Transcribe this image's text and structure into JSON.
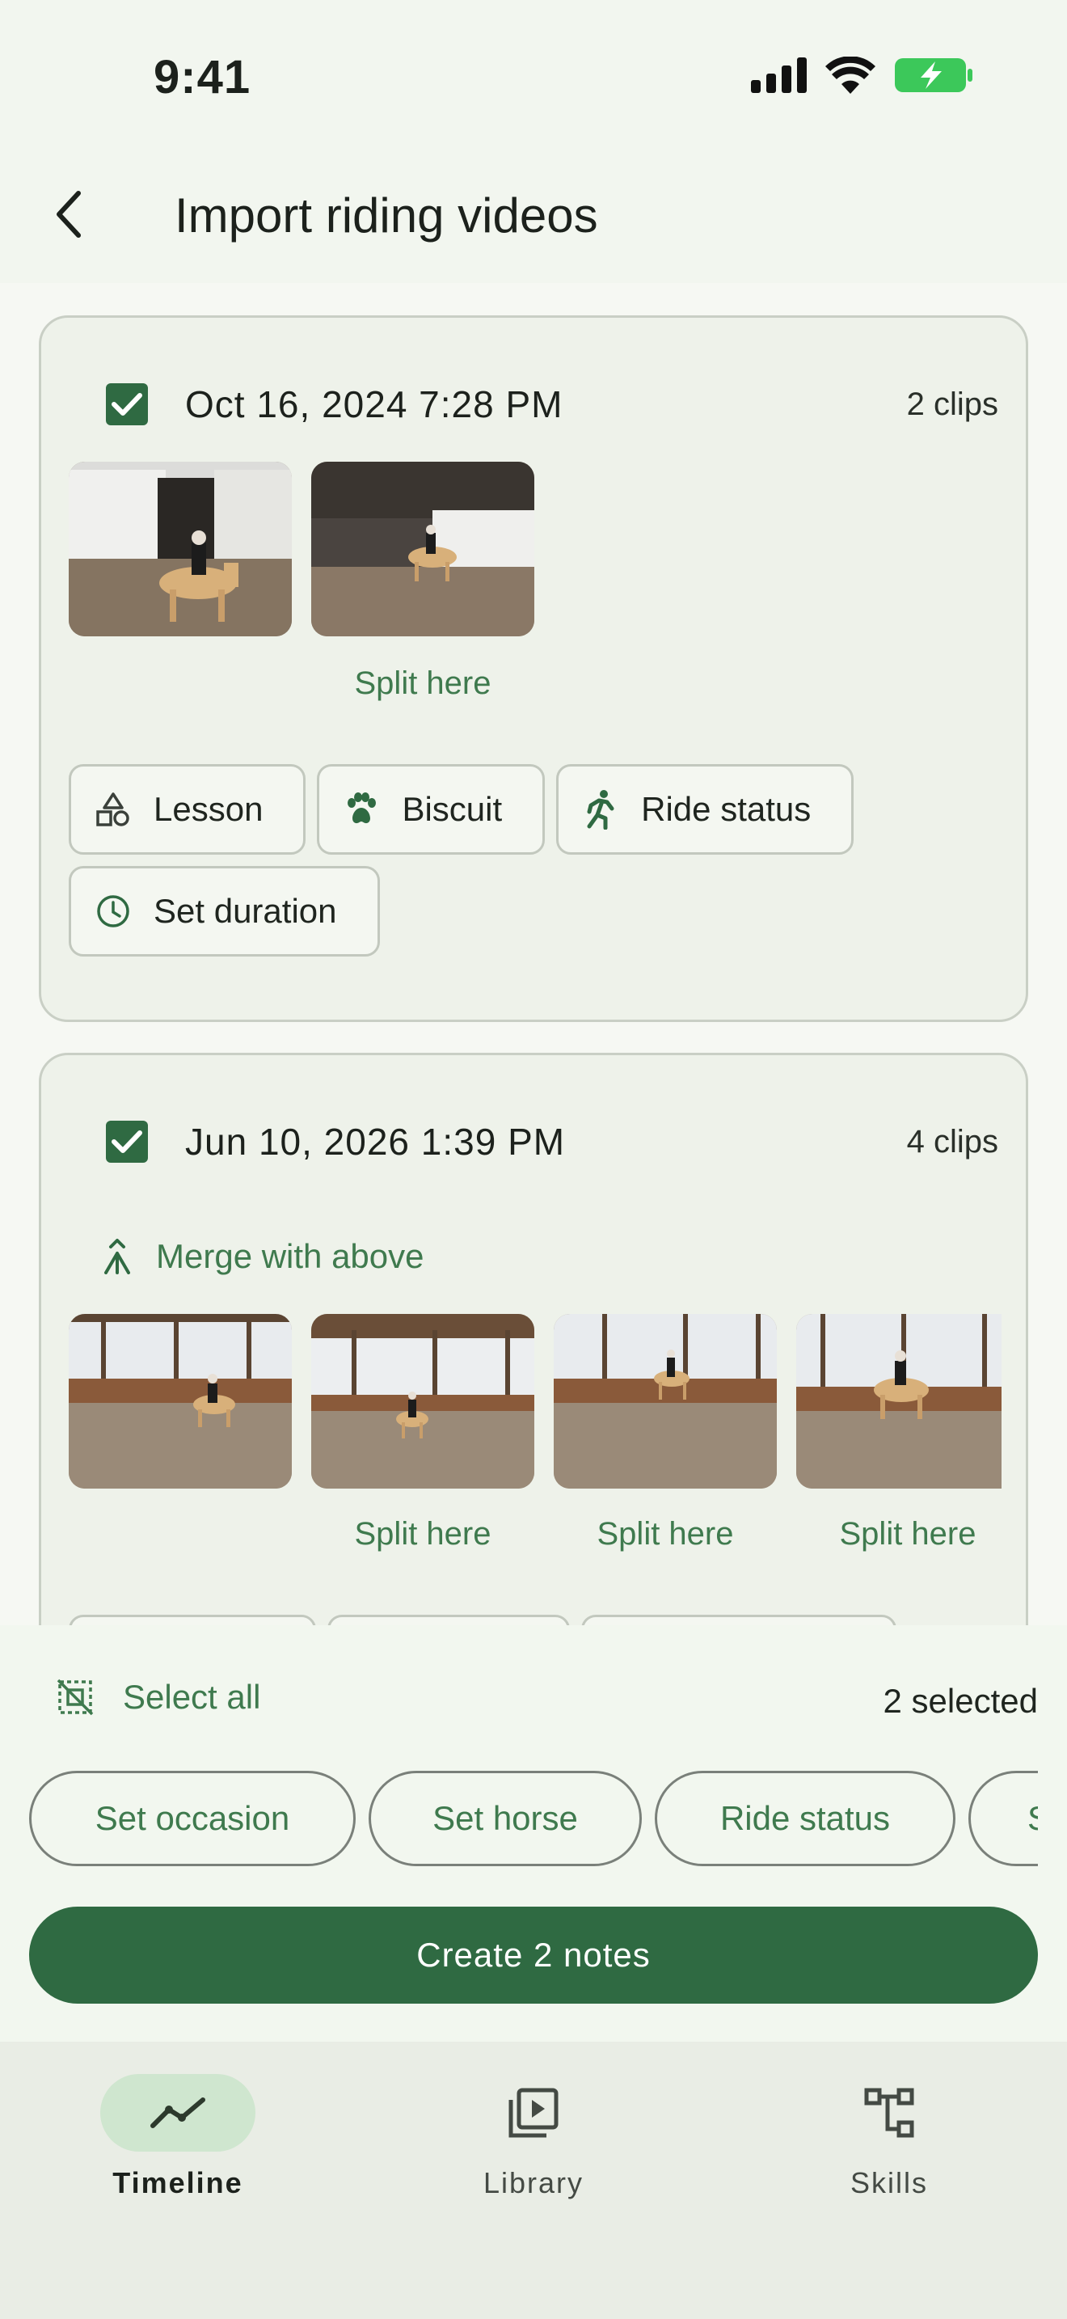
{
  "status_bar": {
    "time": "9:41"
  },
  "app_bar": {
    "title": "Import riding videos"
  },
  "groups": [
    {
      "date": "Oct 16, 2024 7:28 PM",
      "clips": "2 clips",
      "split_labels": [
        "",
        "Split here"
      ],
      "chips": [
        {
          "label": "Lesson",
          "icon": "shapes-icon"
        },
        {
          "label": "Biscuit",
          "icon": "paw-icon"
        },
        {
          "label": "Ride status",
          "icon": "running-icon"
        },
        {
          "label": "Set duration",
          "icon": "clock-icon"
        }
      ]
    },
    {
      "date": "Jun 10, 2026 1:39 PM",
      "clips": "4 clips",
      "merge_label": "Merge with above",
      "split_labels": [
        "",
        "Split here",
        "Split here",
        "Split here"
      ]
    }
  ],
  "action_sheet": {
    "select_all": "Select all",
    "selected_count": "2 selected",
    "pills": [
      "Set occasion",
      "Set horse",
      "Ride status",
      "S"
    ],
    "create_button": "Create 2 notes"
  },
  "bottom_nav": [
    {
      "label": "Timeline",
      "icon": "timeline-icon",
      "active": true
    },
    {
      "label": "Library",
      "icon": "library-icon",
      "active": false
    },
    {
      "label": "Skills",
      "icon": "skills-icon",
      "active": false
    }
  ],
  "colors": {
    "accent": "#2f6a42",
    "accent_text": "#3f7a4e",
    "background": "#f2f5ef"
  }
}
